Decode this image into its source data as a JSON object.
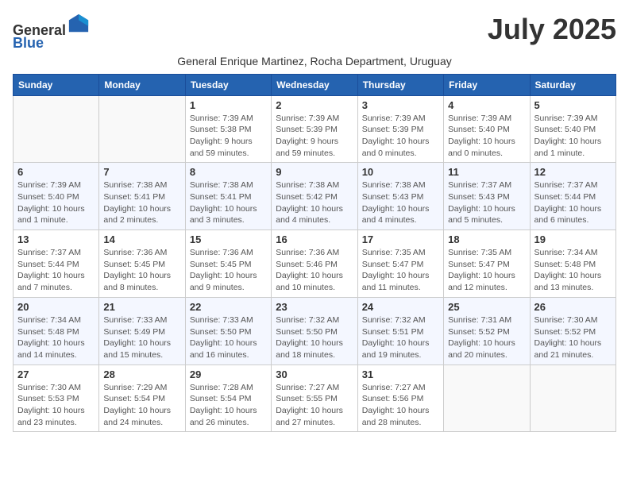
{
  "header": {
    "logo_general": "General",
    "logo_blue": "Blue",
    "month_title": "July 2025",
    "subtitle": "General Enrique Martinez, Rocha Department, Uruguay"
  },
  "weekdays": [
    "Sunday",
    "Monday",
    "Tuesday",
    "Wednesday",
    "Thursday",
    "Friday",
    "Saturday"
  ],
  "weeks": [
    [
      {
        "day": "",
        "info": ""
      },
      {
        "day": "",
        "info": ""
      },
      {
        "day": "1",
        "info": "Sunrise: 7:39 AM\nSunset: 5:38 PM\nDaylight: 9 hours and 59 minutes."
      },
      {
        "day": "2",
        "info": "Sunrise: 7:39 AM\nSunset: 5:39 PM\nDaylight: 9 hours and 59 minutes."
      },
      {
        "day": "3",
        "info": "Sunrise: 7:39 AM\nSunset: 5:39 PM\nDaylight: 10 hours and 0 minutes."
      },
      {
        "day": "4",
        "info": "Sunrise: 7:39 AM\nSunset: 5:40 PM\nDaylight: 10 hours and 0 minutes."
      },
      {
        "day": "5",
        "info": "Sunrise: 7:39 AM\nSunset: 5:40 PM\nDaylight: 10 hours and 1 minute."
      }
    ],
    [
      {
        "day": "6",
        "info": "Sunrise: 7:39 AM\nSunset: 5:40 PM\nDaylight: 10 hours and 1 minute."
      },
      {
        "day": "7",
        "info": "Sunrise: 7:38 AM\nSunset: 5:41 PM\nDaylight: 10 hours and 2 minutes."
      },
      {
        "day": "8",
        "info": "Sunrise: 7:38 AM\nSunset: 5:41 PM\nDaylight: 10 hours and 3 minutes."
      },
      {
        "day": "9",
        "info": "Sunrise: 7:38 AM\nSunset: 5:42 PM\nDaylight: 10 hours and 4 minutes."
      },
      {
        "day": "10",
        "info": "Sunrise: 7:38 AM\nSunset: 5:43 PM\nDaylight: 10 hours and 4 minutes."
      },
      {
        "day": "11",
        "info": "Sunrise: 7:37 AM\nSunset: 5:43 PM\nDaylight: 10 hours and 5 minutes."
      },
      {
        "day": "12",
        "info": "Sunrise: 7:37 AM\nSunset: 5:44 PM\nDaylight: 10 hours and 6 minutes."
      }
    ],
    [
      {
        "day": "13",
        "info": "Sunrise: 7:37 AM\nSunset: 5:44 PM\nDaylight: 10 hours and 7 minutes."
      },
      {
        "day": "14",
        "info": "Sunrise: 7:36 AM\nSunset: 5:45 PM\nDaylight: 10 hours and 8 minutes."
      },
      {
        "day": "15",
        "info": "Sunrise: 7:36 AM\nSunset: 5:45 PM\nDaylight: 10 hours and 9 minutes."
      },
      {
        "day": "16",
        "info": "Sunrise: 7:36 AM\nSunset: 5:46 PM\nDaylight: 10 hours and 10 minutes."
      },
      {
        "day": "17",
        "info": "Sunrise: 7:35 AM\nSunset: 5:47 PM\nDaylight: 10 hours and 11 minutes."
      },
      {
        "day": "18",
        "info": "Sunrise: 7:35 AM\nSunset: 5:47 PM\nDaylight: 10 hours and 12 minutes."
      },
      {
        "day": "19",
        "info": "Sunrise: 7:34 AM\nSunset: 5:48 PM\nDaylight: 10 hours and 13 minutes."
      }
    ],
    [
      {
        "day": "20",
        "info": "Sunrise: 7:34 AM\nSunset: 5:48 PM\nDaylight: 10 hours and 14 minutes."
      },
      {
        "day": "21",
        "info": "Sunrise: 7:33 AM\nSunset: 5:49 PM\nDaylight: 10 hours and 15 minutes."
      },
      {
        "day": "22",
        "info": "Sunrise: 7:33 AM\nSunset: 5:50 PM\nDaylight: 10 hours and 16 minutes."
      },
      {
        "day": "23",
        "info": "Sunrise: 7:32 AM\nSunset: 5:50 PM\nDaylight: 10 hours and 18 minutes."
      },
      {
        "day": "24",
        "info": "Sunrise: 7:32 AM\nSunset: 5:51 PM\nDaylight: 10 hours and 19 minutes."
      },
      {
        "day": "25",
        "info": "Sunrise: 7:31 AM\nSunset: 5:52 PM\nDaylight: 10 hours and 20 minutes."
      },
      {
        "day": "26",
        "info": "Sunrise: 7:30 AM\nSunset: 5:52 PM\nDaylight: 10 hours and 21 minutes."
      }
    ],
    [
      {
        "day": "27",
        "info": "Sunrise: 7:30 AM\nSunset: 5:53 PM\nDaylight: 10 hours and 23 minutes."
      },
      {
        "day": "28",
        "info": "Sunrise: 7:29 AM\nSunset: 5:54 PM\nDaylight: 10 hours and 24 minutes."
      },
      {
        "day": "29",
        "info": "Sunrise: 7:28 AM\nSunset: 5:54 PM\nDaylight: 10 hours and 26 minutes."
      },
      {
        "day": "30",
        "info": "Sunrise: 7:27 AM\nSunset: 5:55 PM\nDaylight: 10 hours and 27 minutes."
      },
      {
        "day": "31",
        "info": "Sunrise: 7:27 AM\nSunset: 5:56 PM\nDaylight: 10 hours and 28 minutes."
      },
      {
        "day": "",
        "info": ""
      },
      {
        "day": "",
        "info": ""
      }
    ]
  ]
}
